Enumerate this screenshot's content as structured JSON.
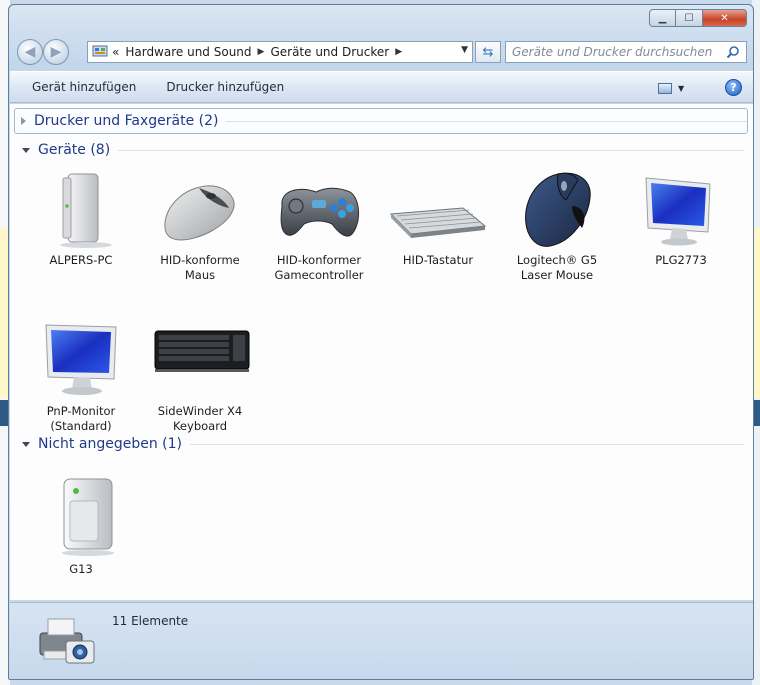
{
  "window": {
    "caption_buttons": {
      "minimize": "minimize-icon",
      "maximize": "maximize-icon",
      "close": "close-icon"
    }
  },
  "address_bar": {
    "prefix": "«",
    "crumbs": [
      "Hardware und Sound",
      "Geräte und Drucker"
    ]
  },
  "search": {
    "placeholder": "Geräte und Drucker durchsuchen"
  },
  "toolbar": {
    "items": [
      "Gerät hinzufügen",
      "Drucker hinzufügen"
    ]
  },
  "groups": {
    "printers": {
      "title": "Drucker und Faxgeräte (2)",
      "state": "collapsed"
    },
    "devices": {
      "title": "Geräte (8)",
      "state": "expanded"
    },
    "unspecified": {
      "title": "Nicht angegeben (1)",
      "state": "expanded"
    }
  },
  "devices": [
    {
      "line1": "ALPERS-PC",
      "line2": "",
      "icon": "computer-tower-icon"
    },
    {
      "line1": "HID-konforme",
      "line2": "Maus",
      "icon": "mouse-icon"
    },
    {
      "line1": "HID-konformer",
      "line2": "Gamecontroller",
      "icon": "gamepad-icon"
    },
    {
      "line1": "HID-Tastatur",
      "line2": "",
      "icon": "keyboard-icon"
    },
    {
      "line1": "Logitech® G5",
      "line2": "Laser Mouse",
      "icon": "gaming-mouse-icon"
    },
    {
      "line1": "PLG2773",
      "line2": "",
      "icon": "monitor-icon"
    },
    {
      "line1": "PnP-Monitor",
      "line2": "(Standard)",
      "icon": "monitor-icon"
    },
    {
      "line1": "SideWinder X4",
      "line2": "Keyboard",
      "icon": "black-keyboard-icon"
    }
  ],
  "unspecified_devices": [
    {
      "line1": "G13",
      "line2": "",
      "icon": "device-box-icon"
    }
  ],
  "status": {
    "text": "11 Elemente",
    "icon": "printer-camera-icon"
  }
}
